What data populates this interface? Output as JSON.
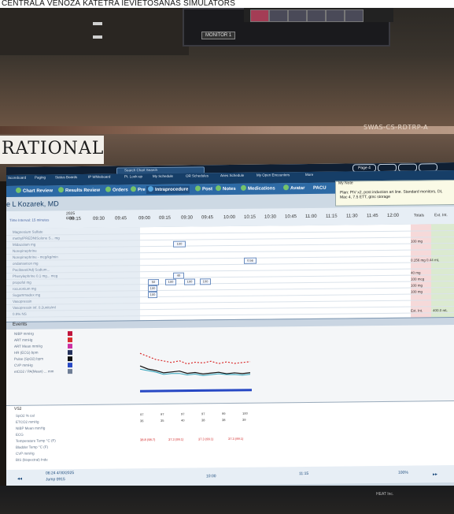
{
  "caption": "CENTRALĀ VĒNOZĀ KATETRA IEVIETOŠANAS SIMULATORS",
  "room": {
    "monitor_label": "MONITOR 1",
    "device_label": "SWAS-CS-RDTRP-A",
    "wall_sign": "RATIONAL"
  },
  "screen": {
    "search_placeholder": "Search Chart Search",
    "page_indicator": "Page 4",
    "toolbar_items": [
      "Scoreboard",
      "Paging",
      "Status Boards",
      "IP Whiteboard",
      "Pt. Look-up",
      "My Schedule",
      "OR Schedules",
      "Anes Schedule",
      "My Open Encounters",
      "More"
    ],
    "tabs": [
      "Chart Review",
      "Results Review",
      "Orders",
      "Pre",
      "Intraprocedure",
      "Post",
      "Notes",
      "Medications",
      "Avatar",
      "PACU"
    ],
    "popup": {
      "title": "My Note",
      "text": "Plan: PIV x2, post induction art line. Standard monitors, DL Mac 4, 7.5 ETT, gtnc storage"
    },
    "provider": "e L Kozarek, MD",
    "time_interval": "Time Interval: 15 minutes",
    "year": "2025",
    "date": "6/30",
    "times": [
      "09:15",
      "09:30",
      "09:45",
      "09:00",
      "09:15",
      "09:30",
      "09:45",
      "10:00",
      "10:15",
      "10:30",
      "10:45",
      "11:00",
      "11:15",
      "11:30",
      "11:45",
      "12:00"
    ],
    "totals": [
      "Totals",
      "Ext. Int."
    ],
    "medications": [
      "Magnesium Sulfate",
      "methylPREDNISolone S... mg",
      "Midazolam mg",
      "Norepinephrine",
      "Norepinephrine - mcg/kg/min",
      "ondansetron mg",
      "Paclitaxel/Adj Sodium...",
      "Phenylephrine 0.1 mg... mcg",
      "propofol mg",
      "rocuronium mg",
      "Sugammadex mg",
      "Vasopressin",
      "Vasopressin inf. 0.2units/ml",
      "0.9% NS"
    ],
    "dose_boxes": [
      "100",
      "0.56",
      "40",
      "50",
      "100",
      "100",
      "100",
      "100",
      "100"
    ],
    "right_values": [
      "100 mg",
      "0.156 mg  0.44 mL",
      "40 mg",
      "100 mcg",
      "100 mg",
      "100 mg",
      "Ext. Int.",
      "400.0 mL"
    ],
    "events_label": "Events",
    "vitals": [
      "NIBP mmHg",
      "ART mmHg",
      "ART Mean mmHg",
      "HR (ECG) bpm",
      "Pulse (SpO2) bpm",
      "CVP mmHg",
      "etCO2 / PA(Mean) ... mm"
    ],
    "vs_header": "VS2",
    "vs_rows": [
      "SpO2 % cal",
      "ETCO2 mmHg",
      "NIBP Mean mmHg",
      "ECG",
      "Temperature Temp °C (F)",
      "Bladder Temp °C (F)",
      "CVP mmHg",
      "BIS (bispectral) Inde"
    ],
    "cell_values": [
      "97",
      "97",
      "97",
      "97",
      "99",
      "100",
      "36",
      "35",
      "40",
      "38",
      "38",
      "39"
    ],
    "red_values": [
      "38.8 (98.7)",
      "37.3 (99.1)",
      "37.3 (99.1)",
      "37.3 (99.1)"
    ],
    "footer": {
      "time_left": "06:24 4/30/2025",
      "nav_left": "Jump 0915",
      "time_mid": "10:00",
      "time_right": "11:15",
      "zoom": "100%"
    }
  },
  "brand": "HEAT Inc."
}
